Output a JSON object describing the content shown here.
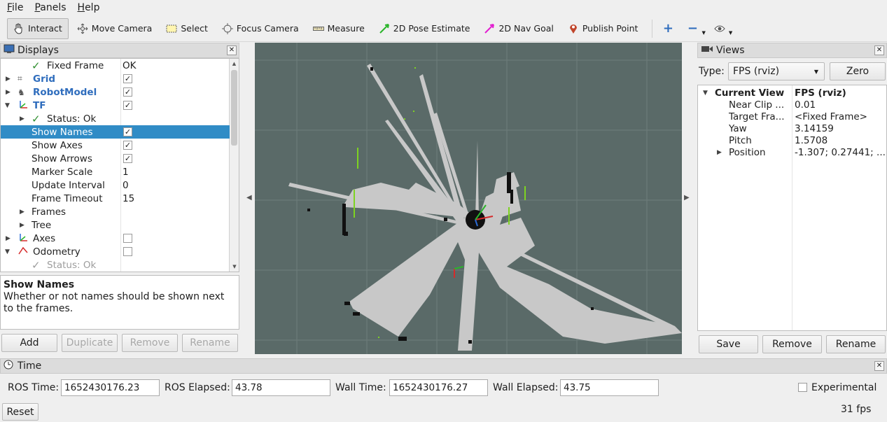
{
  "menu": [
    "File",
    "Panels",
    "Help"
  ],
  "toolbar": {
    "tools": [
      {
        "label": "Interact",
        "icon": "cursor-icon"
      },
      {
        "label": "Move Camera",
        "icon": "move-camera-icon"
      },
      {
        "label": "Select",
        "icon": "select-icon"
      },
      {
        "label": "Focus Camera",
        "icon": "focus-camera-icon"
      },
      {
        "label": "Measure",
        "icon": "measure-icon"
      },
      {
        "label": "2D Pose Estimate",
        "icon": "pose-estimate-icon"
      },
      {
        "label": "2D Nav Goal",
        "icon": "nav-goal-icon"
      },
      {
        "label": "Publish Point",
        "icon": "publish-point-icon"
      }
    ]
  },
  "displays": {
    "title": "Displays",
    "rows": [
      {
        "name": "Fixed Frame",
        "value": "OK"
      },
      {
        "name": "Grid"
      },
      {
        "name": "RobotModel"
      },
      {
        "name": "TF"
      },
      {
        "name": "Status: Ok"
      },
      {
        "name": "Show Names"
      },
      {
        "name": "Show Axes"
      },
      {
        "name": "Show Arrows"
      },
      {
        "name": "Marker Scale",
        "value": "1"
      },
      {
        "name": "Update Interval",
        "value": "0"
      },
      {
        "name": "Frame Timeout",
        "value": "15"
      },
      {
        "name": "Frames"
      },
      {
        "name": "Tree"
      },
      {
        "name": "Axes"
      },
      {
        "name": "Odometry"
      },
      {
        "name": "Status: Ok"
      }
    ],
    "help_title": "Show Names",
    "help_text": "Whether or not names should be shown next to the frames.",
    "buttons": {
      "add": "Add",
      "duplicate": "Duplicate",
      "remove": "Remove",
      "rename": "Rename"
    }
  },
  "views": {
    "title": "Views",
    "type_label": "Type:",
    "type_value": "FPS (rviz)",
    "zero": "Zero",
    "current_view": "Current View",
    "current_view_value": "FPS (rviz)",
    "props": [
      {
        "name": "Near Clip ...",
        "value": "0.01"
      },
      {
        "name": "Target Fra...",
        "value": "<Fixed Frame>"
      },
      {
        "name": "Yaw",
        "value": "3.14159"
      },
      {
        "name": "Pitch",
        "value": "1.5708"
      },
      {
        "name": "Position",
        "value": "-1.307; 0.27441; ..."
      }
    ],
    "buttons": {
      "save": "Save",
      "remove": "Remove",
      "rename": "Rename"
    }
  },
  "time": {
    "title": "Time",
    "ros_time_label": "ROS Time:",
    "ros_time": "1652430176.23",
    "ros_elapsed_label": "ROS Elapsed:",
    "ros_elapsed": "43.78",
    "wall_time_label": "Wall Time:",
    "wall_time": "1652430176.27",
    "wall_elapsed_label": "Wall Elapsed:",
    "wall_elapsed": "43.75",
    "experimental": "Experimental",
    "reset": "Reset",
    "fps": "31 fps"
  },
  "colors": {
    "viewport_bg": "#5a6a68",
    "map_free": "#c8c8c8",
    "selection": "#308cc6",
    "laser": "#7ed321"
  }
}
